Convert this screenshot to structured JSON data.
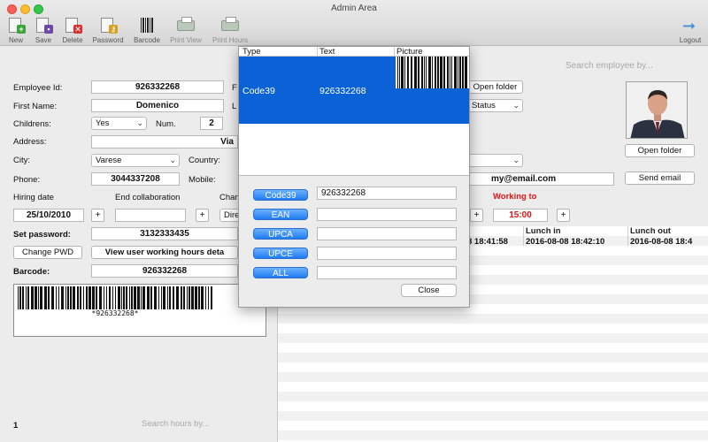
{
  "window": {
    "title": "Admin Area"
  },
  "toolbar": {
    "new": "New",
    "save": "Save",
    "delete": "Delete",
    "password": "Password",
    "barcode": "Barcode",
    "print_view": "Print View",
    "print_hours": "Print Hours",
    "logout": "Logout"
  },
  "employee": {
    "id_label": "Employee Id:",
    "id_value": "926332268",
    "id_cut": "F",
    "first_name_label": "First Name:",
    "first_name_value": "Domenico",
    "last_cut": "L",
    "childrens_label": "Childrens:",
    "childrens_value": "Yes",
    "num_label": "Num.",
    "num_value": "2",
    "address_label": "Address:",
    "address_value": "Via",
    "city_label": "City:",
    "city_value": "Varese",
    "country_label": "Country:",
    "phone_label": "Phone:",
    "phone_value": "3044337208",
    "mobile_label": "Mobile:",
    "hiring_label": "Hiring date",
    "hiring_value": "25/10/2010",
    "end_label": "End collaboration",
    "change_cut": "Chan",
    "dire_cut": "Dire",
    "password_label": "Set password:",
    "password_value": "3132333435",
    "change_pwd": "Change PWD",
    "view_hours": "View user working hours deta",
    "barcode_label": "Barcode:",
    "barcode_value": "926332268",
    "barcode_text": "*926332268*"
  },
  "left_footer": {
    "count": "1",
    "search_hours_placeholder": "Search hours by..."
  },
  "right": {
    "search_employee_placeholder": "Search employee by...",
    "open_folder_top": "Open folder",
    "status_value": "Status",
    "open_folder": "Open folder",
    "email_value": "my@email.com",
    "send_email": "Send email",
    "working_to_label": "Working to",
    "working_to_value": "15:00",
    "columns": [
      "Lunch in",
      "Lunch out"
    ],
    "row": [
      "8 18:41:58",
      "2016-08-08 18:42:10",
      "2016-08-08 18:4"
    ]
  },
  "popup": {
    "headers": [
      "Type",
      "Text",
      "Picture"
    ],
    "selected_row": {
      "type": "Code39",
      "text": "926332268"
    },
    "buttons": [
      "Code39",
      "EAN",
      "UPCA",
      "UPCE",
      "ALL"
    ],
    "values": [
      "926332268",
      "",
      "",
      "",
      ""
    ],
    "close": "Close"
  },
  "colors": {
    "selection": "#0a62d6",
    "accent_red": "#e01818",
    "button_blue": "#1f7cf2"
  }
}
